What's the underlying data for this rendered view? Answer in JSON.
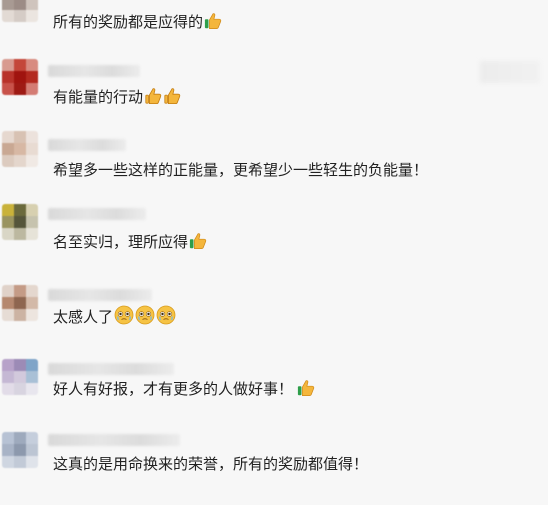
{
  "comments": [
    {
      "text": "所有的奖励都是应得的",
      "emojis": [
        "thumbs-up-icon"
      ]
    },
    {
      "text": "有能量的行动",
      "emojis": [
        "thumbs-up-icon",
        "thumbs-up-icon"
      ]
    },
    {
      "text": "希望多一些这样的正能量，更希望少一些轻生的负能量！",
      "emojis": []
    },
    {
      "text": "名至实归，理所应得",
      "emojis": [
        "thumbs-up-icon"
      ]
    },
    {
      "text": "太感人了",
      "emojis": [
        "crying-face-icon",
        "crying-face-icon",
        "crying-face-icon"
      ]
    },
    {
      "text": "好人有好报，才有更多的人做好事！",
      "emojis": [
        "thumbs-up-icon"
      ]
    },
    {
      "text": "这真的是用命换来的荣誉，所有的奖励都值得！",
      "emojis": []
    }
  ]
}
